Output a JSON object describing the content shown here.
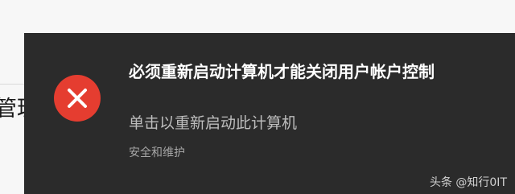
{
  "background": {
    "partial_text": "管理"
  },
  "toast": {
    "icon": "error-x-icon",
    "icon_color": "#e53d30",
    "background_color": "#2b2b2b",
    "title": "必须重新启动计算机才能关闭用户帐户控制",
    "message": "单击以重新启动此计算机",
    "source": "安全和维护"
  },
  "watermark": {
    "text": "头条 @知行0IT"
  }
}
